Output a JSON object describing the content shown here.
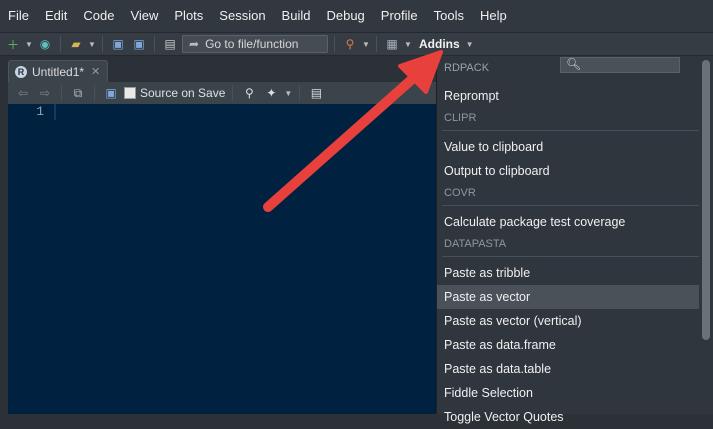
{
  "menu": [
    "File",
    "Edit",
    "Code",
    "View",
    "Plots",
    "Session",
    "Build",
    "Debug",
    "Profile",
    "Tools",
    "Help"
  ],
  "toolbar": {
    "goto_label": "Go to file/function",
    "addins_label": "Addins"
  },
  "editor": {
    "tab_title": "Untitled1*",
    "source_on_save": "Source on Save",
    "line_number": "1"
  },
  "addins_menu": {
    "search_placeholder": "",
    "groups": [
      {
        "name": "RDPACK",
        "items": [
          "Reprompt"
        ]
      },
      {
        "name": "CLIPR",
        "items": [
          "Value to clipboard",
          "Output to clipboard"
        ]
      },
      {
        "name": "COVR",
        "items": [
          "Calculate package test coverage"
        ]
      },
      {
        "name": "DATAPASTA",
        "items": [
          "Paste as tribble",
          "Paste as vector",
          "Paste as vector (vertical)",
          "Paste as data.frame",
          "Paste as data.table",
          "Fiddle Selection",
          "Toggle Vector Quotes"
        ]
      }
    ],
    "highlighted": "Paste as vector"
  },
  "colors": {
    "arrow": "#e8403c",
    "editor_bg": "#002240",
    "highlight": "#4a5158"
  }
}
